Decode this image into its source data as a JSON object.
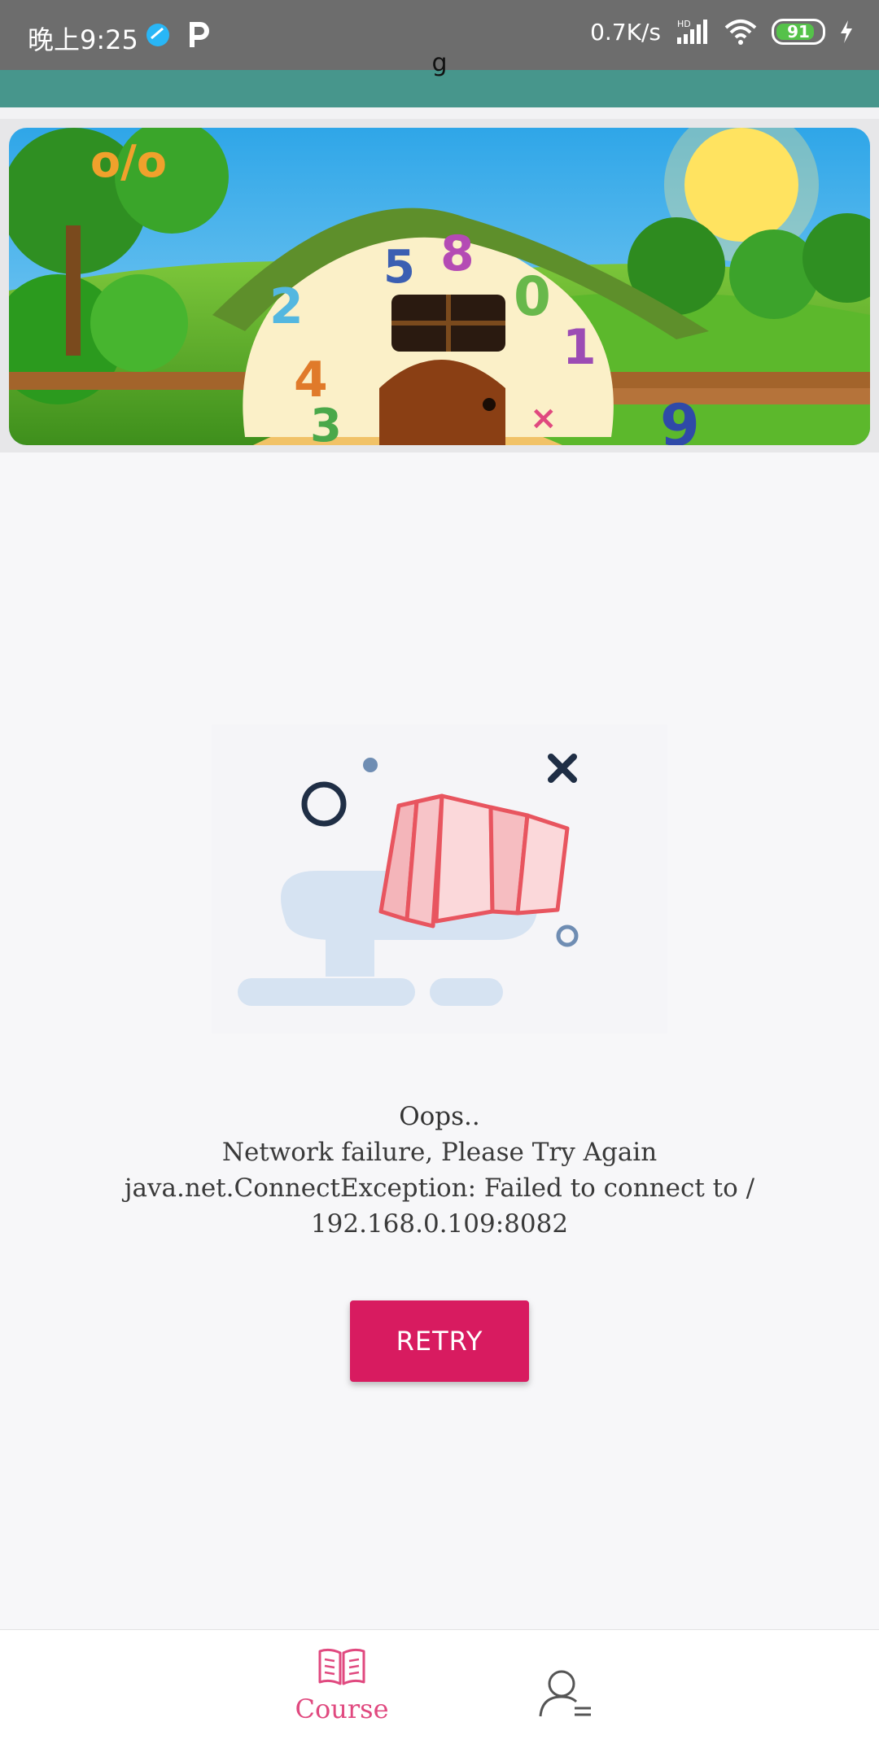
{
  "status_bar": {
    "time": "晚上9:25",
    "net_speed": "0.7K/s",
    "hd_label": "HD",
    "battery": "91"
  },
  "toolbar": {
    "title": "g"
  },
  "error": {
    "title": "Oops..",
    "message_line1": "Network failure, Please Try Again",
    "message_line2": "java.net.ConnectException: Failed to connect to /",
    "message_line3": "192.168.0.109:8082"
  },
  "actions": {
    "retry_label": "RETRY"
  },
  "bottom_nav": {
    "course_label": "Course"
  },
  "colors": {
    "accent": "#d81b60",
    "toolbar": "#47968c",
    "nav_active": "#e0497f"
  },
  "icons": [
    "signal-icon",
    "wifi-icon",
    "battery-icon",
    "charging-icon",
    "book-icon",
    "profile-icon"
  ]
}
